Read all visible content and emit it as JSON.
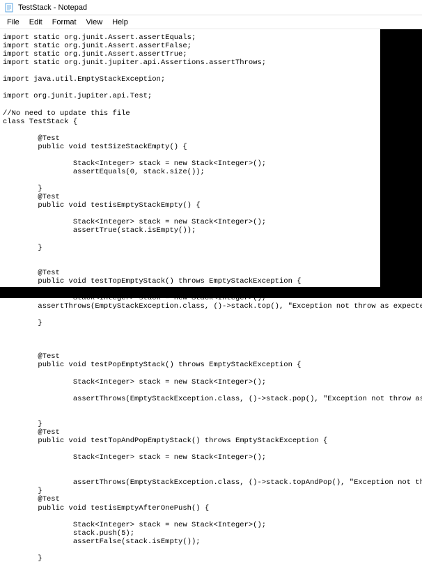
{
  "window": {
    "title": "TestStack - Notepad"
  },
  "menu": {
    "file": "File",
    "edit": "Edit",
    "format": "Format",
    "view": "View",
    "help": "Help"
  },
  "code": "import static org.junit.Assert.assertEquals;\nimport static org.junit.Assert.assertFalse;\nimport static org.junit.Assert.assertTrue;\nimport static org.junit.jupiter.api.Assertions.assertThrows;\n\nimport java.util.EmptyStackException;\n\nimport org.junit.jupiter.api.Test;\n\n//No need to update this file\nclass TestStack {\n\n        @Test\n        public void testSizeStackEmpty() {\n\n                Stack<Integer> stack = new Stack<Integer>();\n                assertEquals(0, stack.size());\n\n        }\n        @Test\n        public void testisEmptyStackEmpty() {\n\n                Stack<Integer> stack = new Stack<Integer>();\n                assertTrue(stack.isEmpty());\n\n        }\n\n\n        @Test\n        public void testTopEmptyStack() throws EmptyStackException {\n\n                Stack<Integer> stack = new Stack<Integer>();\n        assertThrows(EmptyStackException.class, ()->stack.top(), \"Exception not throw as expected\");\n\n        }\n\n\n\n        @Test\n        public void testPopEmptyStack() throws EmptyStackException {\n\n                Stack<Integer> stack = new Stack<Integer>();\n\n                assertThrows(EmptyStackException.class, ()->stack.pop(), \"Exception not throw as expected\");\n\n\n        }\n        @Test\n        public void testTopAndPopEmptyStack() throws EmptyStackException {\n\n                Stack<Integer> stack = new Stack<Integer>();\n\n\n                assertThrows(EmptyStackException.class, ()->stack.topAndPop(), \"Exception not throw as expected\");\n        }\n        @Test\n        public void testisEmptyAfterOnePush() {\n\n                Stack<Integer> stack = new Stack<Integer>();\n                stack.push(5);\n                assertFalse(stack.isEmpty());\n\n        }"
}
